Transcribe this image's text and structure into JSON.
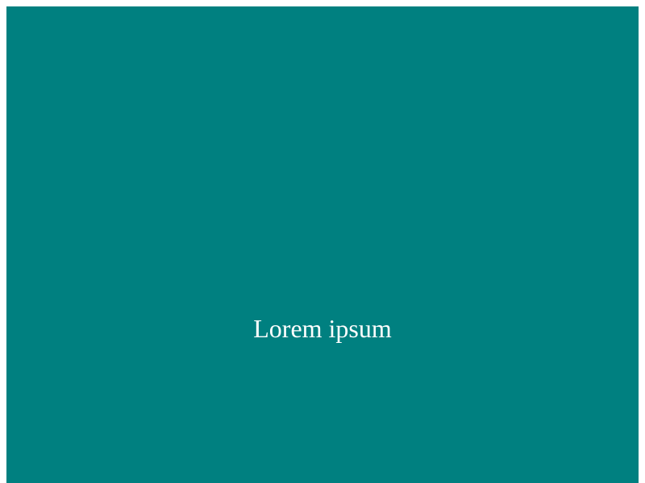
{
  "content": {
    "text": "Lorem ipsum"
  },
  "colors": {
    "background": "#008080",
    "text": "#ffffff",
    "page": "#ffffff"
  }
}
